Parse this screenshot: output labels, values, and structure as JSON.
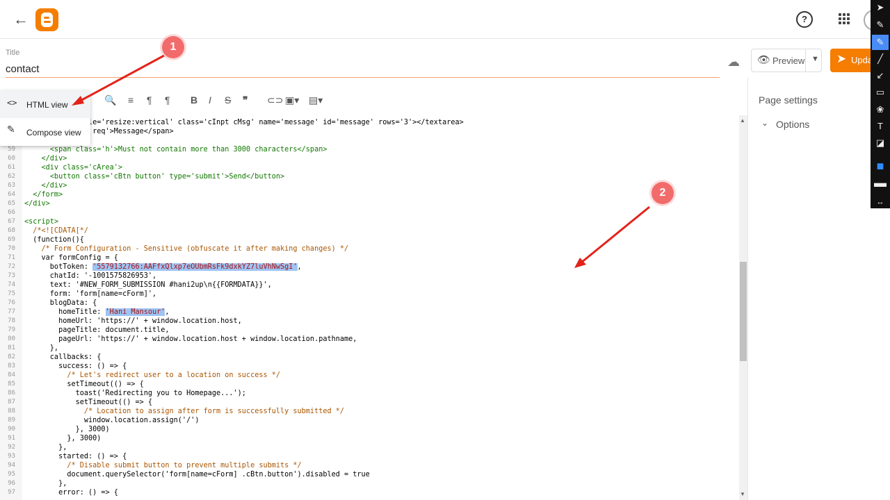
{
  "topbar": {
    "back_icon": "arrow-back-icon",
    "logo": "blogger-logo",
    "help": "?",
    "apps_icon": "apps-grid-icon"
  },
  "title": {
    "label": "Title",
    "value": "contact"
  },
  "actions": {
    "preview_label": "Preview",
    "update_label": "Update"
  },
  "view_menu": {
    "items": [
      {
        "icon": "<>",
        "label": "HTML view"
      },
      {
        "icon": "✎",
        "label": "Compose view"
      }
    ]
  },
  "page_settings": {
    "title": "Page settings",
    "options_label": "Options"
  },
  "callouts": {
    "first": "1",
    "second": "2"
  },
  "colors": {
    "accent": "#f57d00",
    "callout": "#f26b6b",
    "arrow": "#e2231a",
    "highlight": "#9fc4f3"
  },
  "code_lines": [
    {
      "n": "",
      "text": "            style='resize:vertical' class='cInpt cMsg' name='message' id='message' rows='3'></textarea>"
    },
    {
      "n": "",
      "text": "          ss='n req'>Message</span>"
    },
    {
      "n": "",
      "text": ""
    },
    {
      "n": "59",
      "text": "      <span class='h'>Must not contain more than 3000 characters</span>"
    },
    {
      "n": "60",
      "text": "    </div>"
    },
    {
      "n": "61",
      "text": "    <div class='cArea'>"
    },
    {
      "n": "62",
      "text": "      <button class='cBtn button' type='submit'>Send</button>"
    },
    {
      "n": "63",
      "text": "    </div>"
    },
    {
      "n": "64",
      "text": "  </form>"
    },
    {
      "n": "65",
      "text": "</div>"
    },
    {
      "n": "66",
      "text": ""
    },
    {
      "n": "67",
      "text": "<script>"
    },
    {
      "n": "68",
      "text": "  /*<![CDATA[*/"
    },
    {
      "n": "69",
      "text": "  (function(){"
    },
    {
      "n": "70",
      "text": "    /* Form Configuration - Sensitive (obfuscate it after making changes) */"
    },
    {
      "n": "71",
      "text": "    var formConfig = {"
    },
    {
      "n": "72",
      "pre": "      botToken: ",
      "hl": "'5579132766:AAFfxQlxp7eOUbmRsFk9dxkYZ7luVhNwSgI'",
      "post": ","
    },
    {
      "n": "73",
      "text": "      chatId: '-1001575826953',"
    },
    {
      "n": "74",
      "text": "      text: '#NEW_FORM_SUBMISSION #hani2up\\n{{FORMDATA}}',"
    },
    {
      "n": "75",
      "text": "      form: 'form[name=cForm]',"
    },
    {
      "n": "76",
      "text": "      blogData: {"
    },
    {
      "n": "77",
      "pre": "        homeTitle: ",
      "hl": "'Hani Mansour'",
      "post": ","
    },
    {
      "n": "78",
      "text": "        homeUrl: 'https://' + window.location.host,"
    },
    {
      "n": "79",
      "text": "        pageTitle: document.title,"
    },
    {
      "n": "80",
      "text": "        pageUrl: 'https://' + window.location.host + window.location.pathname,"
    },
    {
      "n": "81",
      "text": "      },"
    },
    {
      "n": "82",
      "text": "      callbacks: {"
    },
    {
      "n": "83",
      "text": "        success: () => {"
    },
    {
      "n": "84",
      "text": "          /* Let's redirect user to a location on success */"
    },
    {
      "n": "85",
      "text": "          setTimeout(() => {"
    },
    {
      "n": "86",
      "text": "            toast('Redirecting you to Homepage...');"
    },
    {
      "n": "87",
      "text": "            setTimeout(() => {"
    },
    {
      "n": "88",
      "text": "              /* Location to assign after form is successfully submitted */"
    },
    {
      "n": "89",
      "text": "              window.location.assign('/')"
    },
    {
      "n": "90",
      "text": "            }, 3000)"
    },
    {
      "n": "91",
      "text": "          }, 3000)"
    },
    {
      "n": "92",
      "text": "        },"
    },
    {
      "n": "93",
      "text": "        started: () => {"
    },
    {
      "n": "94",
      "text": "          /* Disable submit button to prevent multiple submits */"
    },
    {
      "n": "95",
      "text": "          document.querySelector('form[name=cForm] .cBtn.button').disabled = true"
    },
    {
      "n": "96",
      "text": "        },"
    },
    {
      "n": "97",
      "text": "        error: () => {"
    }
  ]
}
